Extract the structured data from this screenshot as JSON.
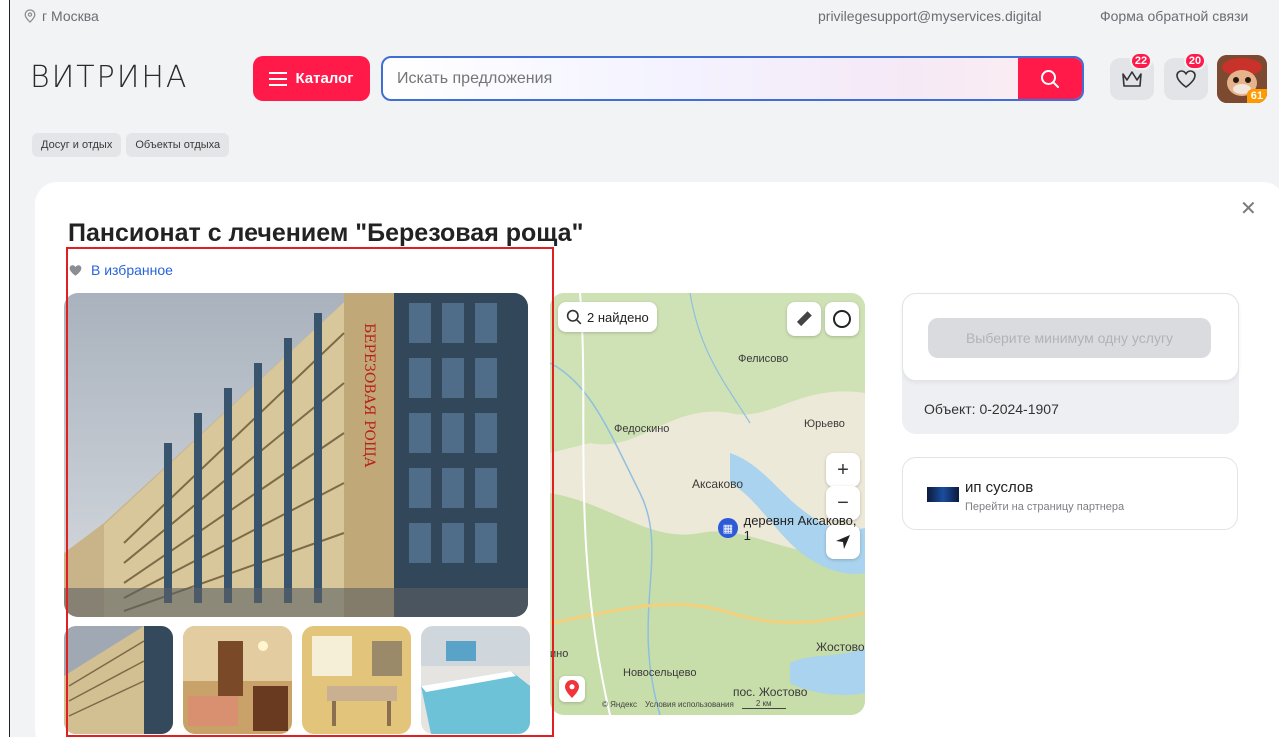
{
  "topbar": {
    "city": "г Москва",
    "email": "privilegesupport@myservices.digital",
    "feedback": "Форма обратной связи"
  },
  "header": {
    "logo": "ВИТРИНА",
    "catalog_label": "Каталог",
    "search_placeholder": "Искать предложения",
    "cart_count": "22",
    "favorites_count": "20",
    "avatar_badge": "61"
  },
  "breadcrumbs": [
    "Досуг и отдых",
    "Объекты отдыха"
  ],
  "card": {
    "title": "Пансионат с лечением \"Березовая роща\"",
    "favorite_label": "В избранное",
    "sign_text": "БЕРЕЗОВАЯ РОЩА"
  },
  "map": {
    "found_label": "2 найдено",
    "places": [
      "Фелисово",
      "Федоскино",
      "Юрьево",
      "Аксаково",
      "Жостово",
      "Новосельцево",
      "пос. Жостово",
      "ино"
    ],
    "pin_label": "деревня Аксаково, 1",
    "yandex": "© Яндекс",
    "terms": "Условия использования",
    "scale": "2 км",
    "zoom_in": "+",
    "zoom_out": "−"
  },
  "sidebar": {
    "choose_button": "Выберите минимум одну услугу",
    "object_label": "Объект: 0-2024-1907",
    "partner_name": "ип суслов",
    "partner_link": "Перейти на страницу партнера"
  },
  "colors": {
    "accent": "#ff1a4a",
    "link": "#2764d8",
    "highlight_outline": "#e02020"
  }
}
